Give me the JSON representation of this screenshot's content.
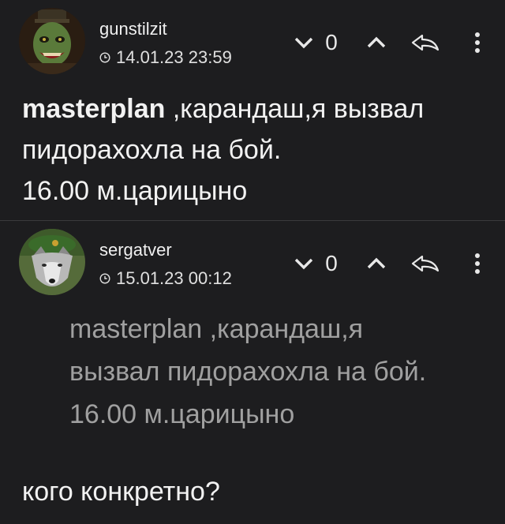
{
  "comments": [
    {
      "username": "gunstilzit",
      "date": "14.01.23 23:59",
      "score": "0",
      "body": {
        "mention": "masterplan",
        "line1_rest": " ,карандаш,я вызвал",
        "line2": "пидорахохла на бой.",
        "line3": "16.00 м.царицыно"
      }
    },
    {
      "username": "sergatver",
      "date": "15.01.23 00:12",
      "score": "0",
      "quote": {
        "line1": "masterplan ,карандаш,я",
        "line2": "вызвал пидорахохла на бой.",
        "line3": "16.00 м.царицыно"
      },
      "reply": "кого конкретно?"
    }
  ],
  "icons": {
    "clock": "clock-icon",
    "downvote": "chevron-down-icon",
    "upvote": "chevron-up-icon",
    "reply": "reply-arrow-icon",
    "more": "more-vertical-icon"
  },
  "colors": {
    "background": "#1d1d1f",
    "text": "#f2f2f2",
    "quote_text": "#a0a0a0",
    "divider": "#3a3a3c"
  }
}
